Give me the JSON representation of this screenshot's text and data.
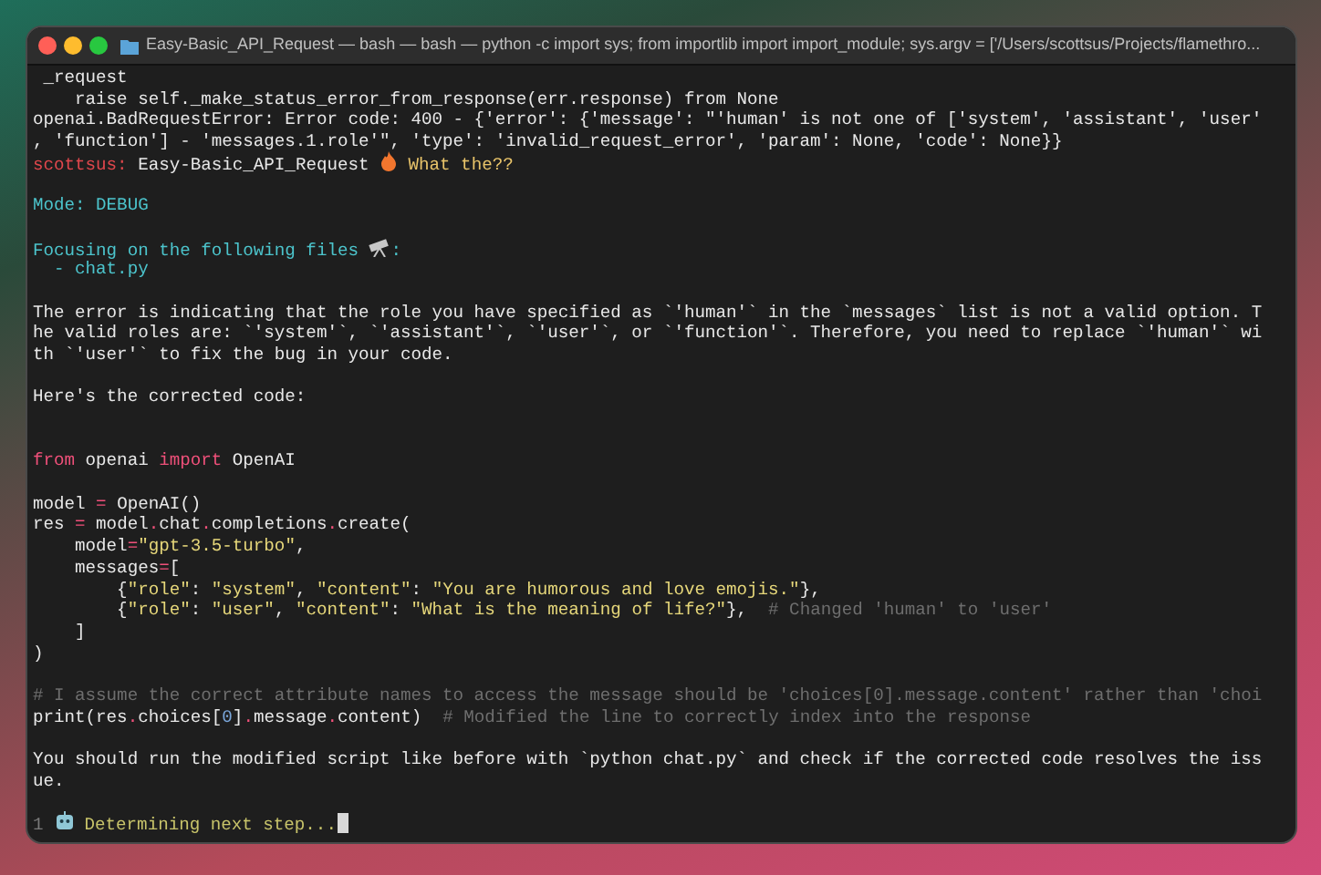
{
  "window": {
    "title": "Easy-Basic_API_Request — bash — bash — python -c import sys; from importlib import import_module; sys.argv = ['/Users/scottsus/Projects/flamethro..."
  },
  "lines": [
    {
      "kind": "text",
      "spans": [
        {
          "kind": "plain",
          "text": " _request"
        }
      ]
    },
    {
      "kind": "text",
      "spans": [
        {
          "kind": "plain",
          "text": "    raise self._make_status_error_from_response(err.response) from None"
        }
      ]
    },
    {
      "kind": "text",
      "spans": [
        {
          "kind": "plain",
          "text": "openai.BadRequestError: Error code: 400 - {'error': {'message': \"'human' is not one of ['system', 'assistant', 'user'"
        }
      ]
    },
    {
      "kind": "text",
      "spans": [
        {
          "kind": "plain",
          "text": ", 'function'] - 'messages.1.role'\", 'type': 'invalid_request_error', 'param': None, 'code': None}}"
        }
      ]
    },
    {
      "kind": "text",
      "spans": [
        {
          "kind": "prompt",
          "text": "scottsus:"
        },
        {
          "kind": "plain",
          "text": " Easy-Basic_API_Request "
        },
        {
          "kind": "flame"
        },
        {
          "kind": "input",
          "text": " What the??"
        }
      ]
    },
    {
      "kind": "blank"
    },
    {
      "kind": "text",
      "spans": [
        {
          "kind": "info",
          "text": "Mode: DEBUG"
        }
      ]
    },
    {
      "kind": "blank"
    },
    {
      "kind": "text",
      "spans": [
        {
          "kind": "info",
          "text": "Focusing on the following files "
        },
        {
          "kind": "telescope"
        },
        {
          "kind": "info",
          "text": ":"
        }
      ]
    },
    {
      "kind": "text",
      "spans": [
        {
          "kind": "info",
          "text": "  - chat.py"
        }
      ]
    },
    {
      "kind": "blank"
    },
    {
      "kind": "text",
      "spans": [
        {
          "kind": "plain",
          "text": "The error is indicating that the role you have specified as `'human'` in the `messages` list is not a valid option. T"
        }
      ]
    },
    {
      "kind": "text",
      "spans": [
        {
          "kind": "plain",
          "text": "he valid roles are: `'system'`, `'assistant'`, `'user'`, or `'function'`. Therefore, you need to replace `'human'` wi"
        }
      ]
    },
    {
      "kind": "text",
      "spans": [
        {
          "kind": "plain",
          "text": "th `'user'` to fix the bug in your code."
        }
      ]
    },
    {
      "kind": "blank"
    },
    {
      "kind": "text",
      "spans": [
        {
          "kind": "plain",
          "text": "Here's the corrected code:"
        }
      ]
    },
    {
      "kind": "blank"
    },
    {
      "kind": "blank"
    },
    {
      "kind": "text",
      "spans": [
        {
          "kind": "keyword",
          "text": "from"
        },
        {
          "kind": "plain",
          "text": " openai "
        },
        {
          "kind": "keyword",
          "text": "import"
        },
        {
          "kind": "plain",
          "text": " OpenAI"
        }
      ]
    },
    {
      "kind": "blank"
    },
    {
      "kind": "text",
      "spans": [
        {
          "kind": "plain",
          "text": "model "
        },
        {
          "kind": "keyword",
          "text": "="
        },
        {
          "kind": "plain",
          "text": " OpenAI()"
        }
      ]
    },
    {
      "kind": "text",
      "spans": [
        {
          "kind": "plain",
          "text": "res "
        },
        {
          "kind": "keyword",
          "text": "="
        },
        {
          "kind": "plain",
          "text": " model"
        },
        {
          "kind": "keyword",
          "text": "."
        },
        {
          "kind": "plain",
          "text": "chat"
        },
        {
          "kind": "keyword",
          "text": "."
        },
        {
          "kind": "plain",
          "text": "completions"
        },
        {
          "kind": "keyword",
          "text": "."
        },
        {
          "kind": "plain",
          "text": "create("
        }
      ]
    },
    {
      "kind": "text",
      "spans": [
        {
          "kind": "plain",
          "text": "    model"
        },
        {
          "kind": "keyword",
          "text": "="
        },
        {
          "kind": "string",
          "text": "\"gpt-3.5-turbo\""
        },
        {
          "kind": "plain",
          "text": ","
        }
      ]
    },
    {
      "kind": "text",
      "spans": [
        {
          "kind": "plain",
          "text": "    messages"
        },
        {
          "kind": "keyword",
          "text": "="
        },
        {
          "kind": "plain",
          "text": "["
        }
      ]
    },
    {
      "kind": "text",
      "spans": [
        {
          "kind": "plain",
          "text": "        {"
        },
        {
          "kind": "string",
          "text": "\"role\""
        },
        {
          "kind": "plain",
          "text": ": "
        },
        {
          "kind": "string",
          "text": "\"system\""
        },
        {
          "kind": "plain",
          "text": ", "
        },
        {
          "kind": "string",
          "text": "\"content\""
        },
        {
          "kind": "plain",
          "text": ": "
        },
        {
          "kind": "string",
          "text": "\"You are humorous and love emojis.\""
        },
        {
          "kind": "plain",
          "text": "},"
        }
      ]
    },
    {
      "kind": "text",
      "spans": [
        {
          "kind": "plain",
          "text": "        {"
        },
        {
          "kind": "string",
          "text": "\"role\""
        },
        {
          "kind": "plain",
          "text": ": "
        },
        {
          "kind": "string",
          "text": "\"user\""
        },
        {
          "kind": "plain",
          "text": ", "
        },
        {
          "kind": "string",
          "text": "\"content\""
        },
        {
          "kind": "plain",
          "text": ": "
        },
        {
          "kind": "string",
          "text": "\"What is the meaning of life?\""
        },
        {
          "kind": "plain",
          "text": "},  "
        },
        {
          "kind": "comment",
          "text": "# Changed 'human' to 'user'"
        }
      ]
    },
    {
      "kind": "text",
      "spans": [
        {
          "kind": "plain",
          "text": "    ]"
        }
      ]
    },
    {
      "kind": "text",
      "spans": [
        {
          "kind": "plain",
          "text": ")"
        }
      ]
    },
    {
      "kind": "blank"
    },
    {
      "kind": "text",
      "spans": [
        {
          "kind": "comment",
          "text": "# I assume the correct attribute names to access the message should be 'choices[0].message.content' rather than 'choi"
        }
      ]
    },
    {
      "kind": "text",
      "spans": [
        {
          "kind": "plain",
          "text": "print(res"
        },
        {
          "kind": "keyword",
          "text": "."
        },
        {
          "kind": "plain",
          "text": "choices["
        },
        {
          "kind": "number",
          "text": "0"
        },
        {
          "kind": "plain",
          "text": "]"
        },
        {
          "kind": "keyword",
          "text": "."
        },
        {
          "kind": "plain",
          "text": "message"
        },
        {
          "kind": "keyword",
          "text": "."
        },
        {
          "kind": "plain",
          "text": "content)  "
        },
        {
          "kind": "comment",
          "text": "# Modified the line to correctly index into the response"
        }
      ]
    },
    {
      "kind": "blank"
    },
    {
      "kind": "text",
      "spans": [
        {
          "kind": "plain",
          "text": "You should run the modified script like before with `python chat.py` and check if the corrected code resolves the iss"
        }
      ]
    },
    {
      "kind": "text",
      "spans": [
        {
          "kind": "plain",
          "text": "ue."
        }
      ]
    },
    {
      "kind": "blank"
    },
    {
      "kind": "text",
      "cursor": true,
      "spans": [
        {
          "kind": "dim",
          "text": "1 "
        },
        {
          "kind": "robot"
        },
        {
          "kind": "status",
          "text": " Determining next step..."
        }
      ]
    }
  ]
}
